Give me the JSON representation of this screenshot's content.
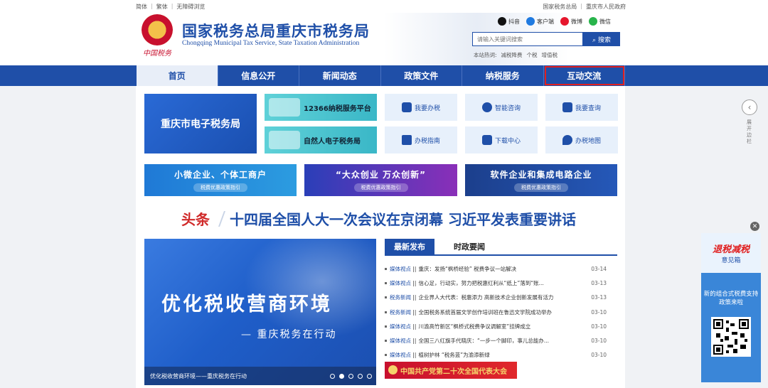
{
  "topbar": {
    "left": [
      "简体",
      "繁体",
      "无障碍浏览"
    ],
    "right": [
      "国家税务总局",
      "重庆市人民政府"
    ]
  },
  "header": {
    "emblem_text": "中国税务",
    "title": "国家税务总局重庆市税务局",
    "subtitle": "Chongqing Municipal Tax Service, State Taxation Administration",
    "social": [
      {
        "label": "抖音",
        "icon": "tiktok-icon",
        "color": "#111111"
      },
      {
        "label": "客户端",
        "icon": "app-client-icon",
        "color": "#1f7ae0"
      },
      {
        "label": "微博",
        "icon": "weibo-icon",
        "color": "#e6162d"
      },
      {
        "label": "微信",
        "icon": "wechat-icon",
        "color": "#28b44b"
      }
    ],
    "search": {
      "placeholder": "请输入关键词搜索",
      "button": "搜索"
    },
    "hot_label": "本站热词:",
    "hot_words": [
      "减税降费",
      "个税",
      "增值税"
    ]
  },
  "nav": {
    "items": [
      "首页",
      "信息公开",
      "新闻动态",
      "政策文件",
      "纳税服务",
      "互动交流"
    ]
  },
  "services": {
    "etax": "重庆市电子税务局",
    "platform_12366": "12366纳税服务平台",
    "natural_person": "自然人电子税务局",
    "grid": [
      {
        "label": "我要办税",
        "icon": "tax-handling-icon"
      },
      {
        "label": "智能咨询",
        "icon": "smart-consult-icon"
      },
      {
        "label": "我要查询",
        "icon": "query-icon"
      },
      {
        "label": "办税指南",
        "icon": "guide-icon"
      },
      {
        "label": "下载中心",
        "icon": "download-icon"
      },
      {
        "label": "办税地图",
        "icon": "map-pin-icon"
      }
    ]
  },
  "banners": [
    {
      "title": "小微企业、个体工商户",
      "tag": "税费优惠政策指引"
    },
    {
      "title": "“大众创业 万众创新”",
      "tag": "税费优惠政策指引"
    },
    {
      "title": "软件企业和集成电路企业",
      "tag": "税费优惠政策指引"
    }
  ],
  "headline": {
    "label": "头条",
    "text": "十四届全国人大一次会议在京闭幕 习近平发表重要讲话"
  },
  "slide": {
    "big": "优化税收营商环境",
    "sub": "— 重庆税务在行动",
    "caption": "优化税收营商环境——重庆税务在行动",
    "dots": 5,
    "active_dot": 2
  },
  "news": {
    "tabs": [
      "最新发布",
      "时政要闻"
    ],
    "items": [
      {
        "cat": "媒体视点",
        "title": "重庆：发扬“枫桥经验” 税费争议一站解决",
        "date": "03-14"
      },
      {
        "cat": "媒体视点",
        "title": "信心足，行动实，努力把税惠红利从“纸上”落到“账...",
        "date": "03-13"
      },
      {
        "cat": "税务新闻",
        "title": "企业界人大代表：税惠添力 高新技术企业创新发展有活力",
        "date": "03-13"
      },
      {
        "cat": "税务新闻",
        "title": "全国税务系统首届文学创作培训班在鲁迅文学院成功举办",
        "date": "03-10"
      },
      {
        "cat": "媒体视点",
        "title": "川渝高竹新区“枫桥式税费争议调解室”挂牌成立",
        "date": "03-10"
      },
      {
        "cat": "媒体视点",
        "title": "全国三八红旗手代晓庆：“一步一个脚印，事儿总能办...",
        "date": "03-10"
      },
      {
        "cat": "媒体视点",
        "title": "植树护林 “税务蓝”为渝添新绿",
        "date": "03-10"
      }
    ],
    "party_banner": "中国共产党第二十次全国代表大会"
  },
  "side": {
    "expand_label": "展开边栏",
    "float_top_a": "退税减税",
    "float_top_b": "意见箱",
    "float_mid": "新的组合式税费支持政策来啦",
    "close": "✕"
  }
}
